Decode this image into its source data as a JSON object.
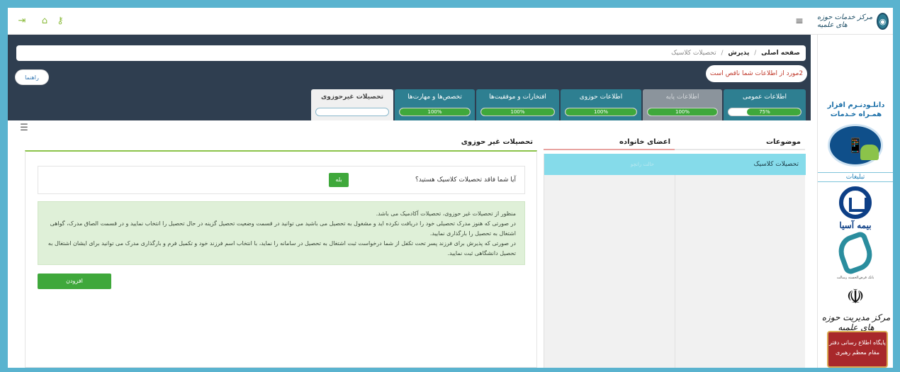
{
  "header": {
    "logo_text": "مرکز خدمات حوزه های علمیه",
    "menu_icon": "hamburger-icon",
    "left_icons": [
      "exit-icon",
      "home-icon",
      "key-icon"
    ]
  },
  "breadcrumb": {
    "home": "صفحه اصلی",
    "section": "پذیرش",
    "current": "تحصیلات کلاسیک",
    "separator": "/"
  },
  "alerts": {
    "incomplete_info": "2مورد از اطلاعات شما ناقص است",
    "help_label": "راهنما"
  },
  "tabs": [
    {
      "label": "اطلاعات عمومی",
      "progress_text": "75%",
      "progress": 0.75,
      "state": "normal"
    },
    {
      "label": "اطلاعات پایه",
      "progress_text": "100%",
      "progress": 1.0,
      "state": "disabled"
    },
    {
      "label": "اطلاعات حوزوی",
      "progress_text": "100%",
      "progress": 1.0,
      "state": "normal"
    },
    {
      "label": "افتخارات و موفقیت‌ها",
      "progress_text": "100%",
      "progress": 1.0,
      "state": "normal"
    },
    {
      "label": "تخصص‌ها و مهارت‌ها",
      "progress_text": "100%",
      "progress": 1.0,
      "state": "normal"
    },
    {
      "label": "تحصیلات غیرحوزوی",
      "progress_text": "",
      "progress": 0,
      "state": "active"
    }
  ],
  "columns": {
    "topics_title": "موضوعات",
    "family_title": "اعضای خانواده",
    "main_title": "تحصیلات غیر حوزوی"
  },
  "topics": [
    {
      "label": "تحصیلات کلاسیک"
    }
  ],
  "family": [
    {
      "label": "حالت رانچو"
    }
  ],
  "question": {
    "text": "آیا شما فاقد تحصیلات کلاسیک هستید؟",
    "yes_label": "بله"
  },
  "info": {
    "line1": "منظور از تحصیلات غیر حوزوی، تحصیلات آکادمیک می باشد.",
    "line2": "در صورتی که هنوز مدرک تحصیلی خود را دریافت نکرده اید و مشغول به تحصیل می باشید می توانید در قسمت وضعیت تحصیل گزینه در حال تحصیل را انتخاب نمایید و در قسمت الصاق مدرک، گواهی اشتغال به تحصیل را بارگذاری نمایید.",
    "line3": "در صورتی که پذیرش برای فرزند پسر تحت تکفل از شما درخواست ثبت اشتغال به تحصیل در سامانه را نماید، با انتخاب اسم فرزند خود و تکمیل فرم و بارگذاری مدرک می توانید برای ایشان اشتغال به تحصیل دانشگاهی ثبت نمایید."
  },
  "add_button": "افزودن",
  "sidebar": {
    "ad_title": "دانلـودنـرم افزار همـراه خـدمات",
    "ads_label": "تبلیغات",
    "asia_text": "بیمه آسیا",
    "rt_caption": "بانک قرض‌الحسنه رسالت",
    "markaz_text": "مرکز مدیریت حوزه های علمیه",
    "banner_text": "پایگاه اطلاع رسانی دفتر مقام معظم رهبری"
  }
}
